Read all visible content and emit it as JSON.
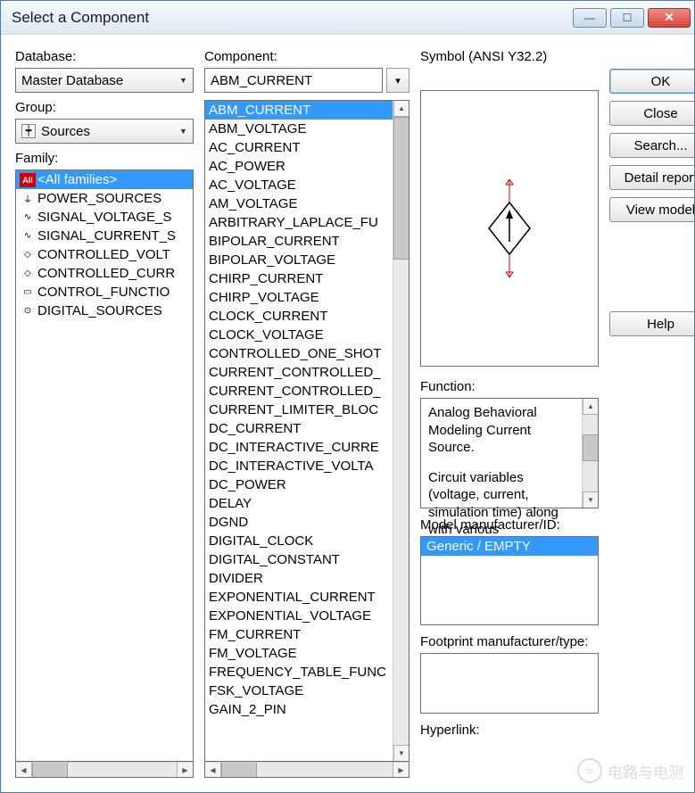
{
  "title": "Select a Component",
  "labels": {
    "database": "Database:",
    "component": "Component:",
    "symbol": "Symbol (ANSI Y32.2)",
    "group": "Group:",
    "family": "Family:",
    "function": "Function:",
    "model": "Model manufacturer/ID:",
    "footprint": "Footprint manufacturer/type:",
    "hyperlink": "Hyperlink:"
  },
  "database_value": "Master Database",
  "group_value": "Sources",
  "component_value": "ABM_CURRENT",
  "buttons": {
    "ok": "OK",
    "close": "Close",
    "search": "Search...",
    "detail": "Detail report",
    "view_model": "View model",
    "help": "Help"
  },
  "families": [
    {
      "icon": "All",
      "label": "<All families>",
      "sel": true
    },
    {
      "icon": "⏚",
      "label": "POWER_SOURCES"
    },
    {
      "icon": "∿",
      "label": "SIGNAL_VOLTAGE_S"
    },
    {
      "icon": "∿",
      "label": "SIGNAL_CURRENT_S"
    },
    {
      "icon": "◇",
      "label": "CONTROLLED_VOLT"
    },
    {
      "icon": "◇",
      "label": "CONTROLLED_CURR"
    },
    {
      "icon": "▭",
      "label": "CONTROL_FUNCTIO"
    },
    {
      "icon": "⊙",
      "label": "DIGITAL_SOURCES"
    }
  ],
  "components": [
    {
      "label": "ABM_CURRENT",
      "sel": true
    },
    {
      "label": "ABM_VOLTAGE"
    },
    {
      "label": "AC_CURRENT"
    },
    {
      "label": "AC_POWER"
    },
    {
      "label": "AC_VOLTAGE"
    },
    {
      "label": "AM_VOLTAGE"
    },
    {
      "label": "ARBITRARY_LAPLACE_FU"
    },
    {
      "label": "BIPOLAR_CURRENT"
    },
    {
      "label": "BIPOLAR_VOLTAGE"
    },
    {
      "label": "CHIRP_CURRENT"
    },
    {
      "label": "CHIRP_VOLTAGE"
    },
    {
      "label": "CLOCK_CURRENT"
    },
    {
      "label": "CLOCK_VOLTAGE"
    },
    {
      "label": "CONTROLLED_ONE_SHOT"
    },
    {
      "label": "CURRENT_CONTROLLED_"
    },
    {
      "label": "CURRENT_CONTROLLED_"
    },
    {
      "label": "CURRENT_LIMITER_BLOC"
    },
    {
      "label": "DC_CURRENT"
    },
    {
      "label": "DC_INTERACTIVE_CURRE"
    },
    {
      "label": "DC_INTERACTIVE_VOLTA"
    },
    {
      "label": "DC_POWER"
    },
    {
      "label": "DELAY"
    },
    {
      "label": "DGND"
    },
    {
      "label": "DIGITAL_CLOCK"
    },
    {
      "label": "DIGITAL_CONSTANT"
    },
    {
      "label": "DIVIDER"
    },
    {
      "label": "EXPONENTIAL_CURRENT"
    },
    {
      "label": "EXPONENTIAL_VOLTAGE"
    },
    {
      "label": "FM_CURRENT"
    },
    {
      "label": "FM_VOLTAGE"
    },
    {
      "label": "FREQUENCY_TABLE_FUNC"
    },
    {
      "label": "FSK_VOLTAGE"
    },
    {
      "label": "GAIN_2_PIN"
    }
  ],
  "function_text_1": "Analog Behavioral Modeling Current Source.",
  "function_text_2": "Circuit variables (voltage, current, simulation time) along with various",
  "model_item": "Generic / EMPTY",
  "watermark": "电路与电测"
}
